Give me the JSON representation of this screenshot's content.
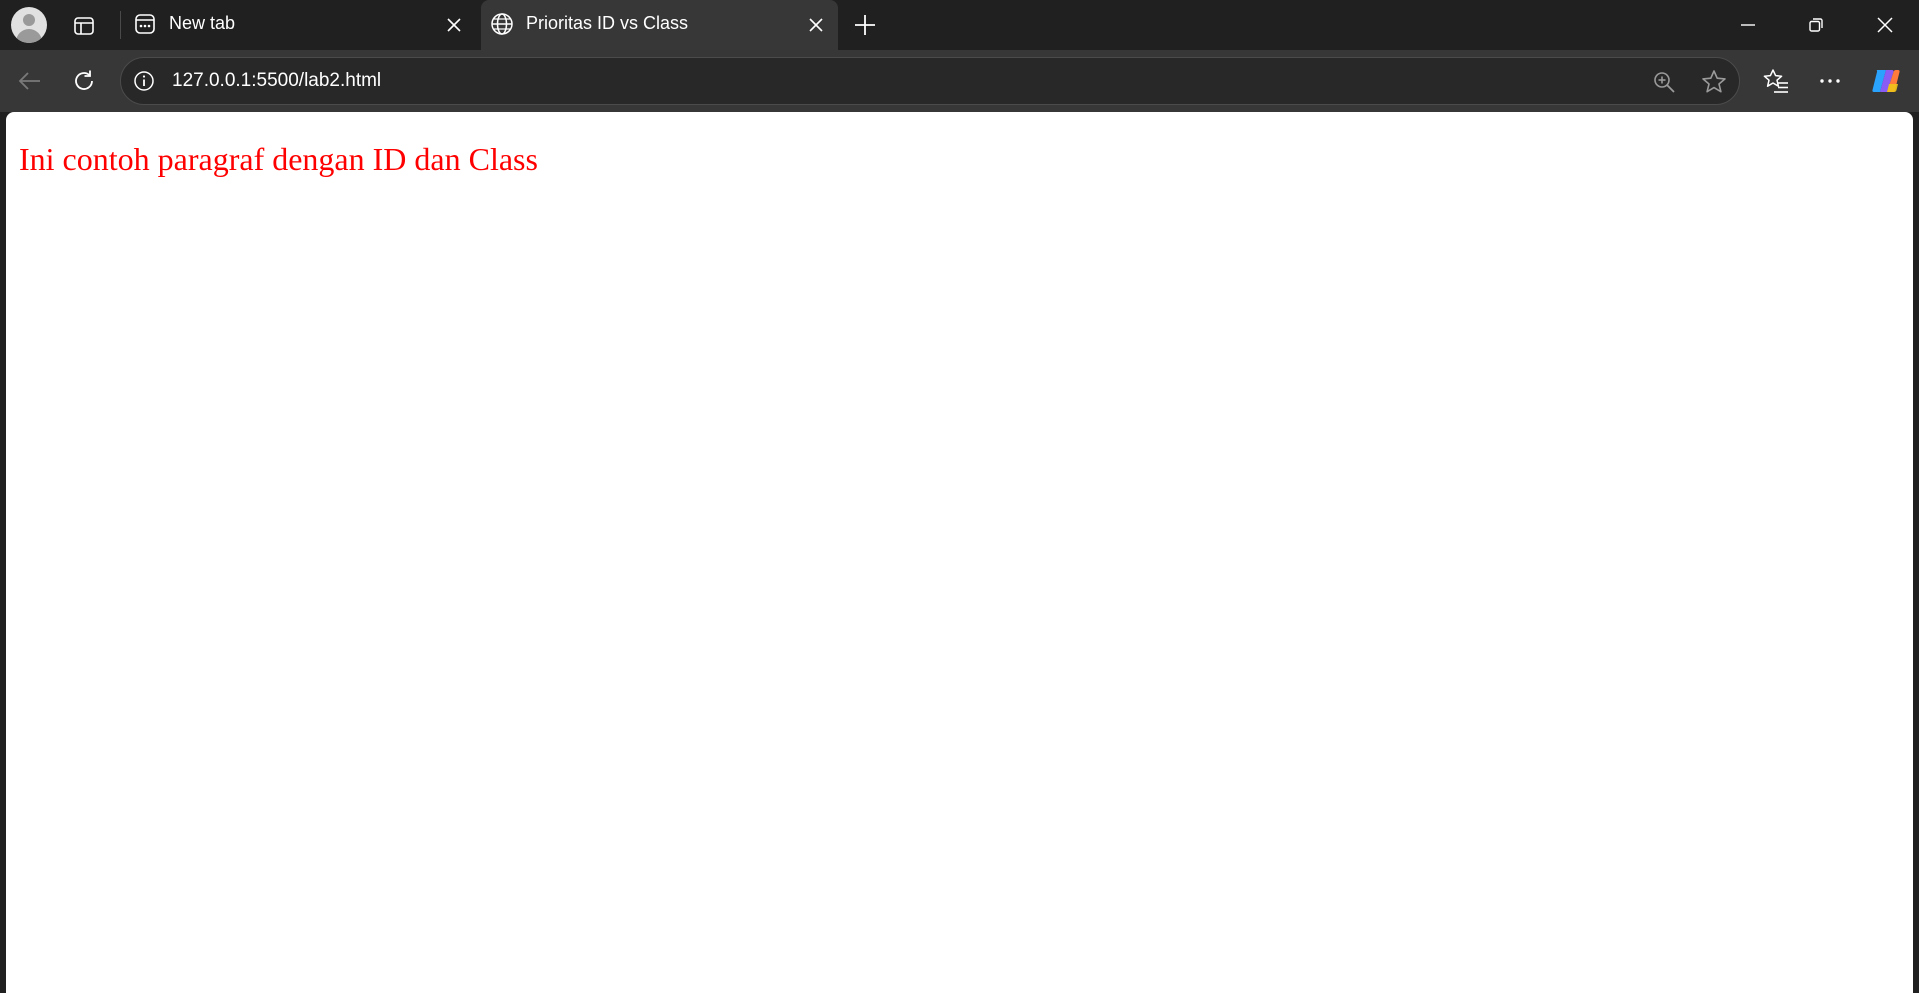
{
  "browser": {
    "tabs": [
      {
        "title": "New tab",
        "favicon": "new-tab-page-icon",
        "active": false
      },
      {
        "title": "Prioritas ID vs Class",
        "favicon": "globe-icon",
        "active": true
      }
    ],
    "address_bar": {
      "url": "127.0.0.1:5500/lab2.html"
    }
  },
  "page": {
    "paragraph": "Ini contoh paragraf dengan ID dan Class",
    "paragraph_color": "#ff0000"
  },
  "theme": {
    "tabstrip_bg": "#202020",
    "active_tab_bg": "#373737",
    "toolbar_bg": "#373737",
    "omnibox_bg": "#282828",
    "content_bg": "#ffffff"
  }
}
